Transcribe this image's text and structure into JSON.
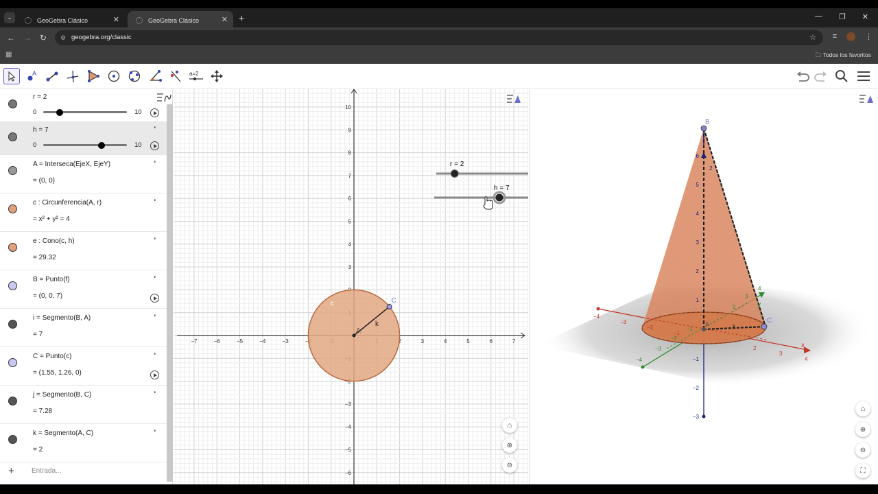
{
  "browser": {
    "tabs": [
      {
        "title": "GeoGebra Clásico",
        "active": false
      },
      {
        "title": "GeoGebra Clásico",
        "active": true
      }
    ],
    "url": "geogebra.org/classic",
    "bookmarks_label": "Todos los favoritos"
  },
  "colors": {
    "accent": "#6557d2",
    "cone_fill": "#d9835a",
    "circle_fill": "#e2a882",
    "point_blue": "#6666cc"
  },
  "toolbar": {
    "tools": [
      "move-tool",
      "point-tool",
      "line-tool",
      "perpendicular-tool",
      "polygon-tool",
      "circle-tool",
      "conic-tool",
      "angle-tool",
      "reflect-tool",
      "slider-tool",
      "move-view-tool"
    ],
    "slider_tool_label": "a=2",
    "right": [
      "undo-icon",
      "redo-icon",
      "search-icon",
      "menu-icon"
    ]
  },
  "algebra": {
    "input_placeholder": "Entrada...",
    "rows": [
      {
        "label": "r = 2",
        "min": "0",
        "max": "10",
        "value": 2,
        "marble": "#777777",
        "kind": "slider"
      },
      {
        "label": "h = 7",
        "min": "0",
        "max": "10",
        "value": 7,
        "marble": "#777777",
        "kind": "slider"
      },
      {
        "label": "A = Interseca(EjeX, EjeY)",
        "value": "= (0, 0)",
        "marble": "#999999"
      },
      {
        "label": "c : Circunferencia(A, r)",
        "value": "= x² + y² = 4",
        "marble": "#e0a07a"
      },
      {
        "label": "e : Cono(c, h)",
        "value": "= 29.32",
        "marble": "#e0a07a"
      },
      {
        "label": "B = Punto(f)",
        "value": "= (0, 0, 7)",
        "marble": "#c8c8f2",
        "play": true
      },
      {
        "label": "i = Segmento(B, A)",
        "value": "= 7",
        "marble": "#555555"
      },
      {
        "label": "C = Punto(c)",
        "value": "= (1.55, 1.26, 0)",
        "marble": "#c8c8f2",
        "play": true
      },
      {
        "label": "j = Segmento(B, C)",
        "value": "= 7.28",
        "marble": "#555555"
      },
      {
        "label": "k = Segmento(A, C)",
        "value": "= 2",
        "marble": "#555555"
      }
    ]
  },
  "graphics2d": {
    "x_ticks": [
      "−7",
      "−6",
      "−5",
      "−4",
      "−3",
      "−2",
      "−1",
      "1",
      "2",
      "3",
      "4",
      "5",
      "6",
      "7"
    ],
    "y_ticks": [
      "10",
      "9",
      "8",
      "7",
      "6",
      "5",
      "4",
      "3",
      "2",
      "1",
      "−1",
      "−2",
      "−3",
      "−4",
      "−5",
      "−6"
    ],
    "labels": {
      "A": "A",
      "C": "C",
      "c": "c",
      "k": "k"
    },
    "slider_r": {
      "label": "r = 2",
      "value": 2
    },
    "slider_h": {
      "label": "h = 7",
      "value": 7
    }
  },
  "graphics3d": {
    "labels": {
      "B": "B",
      "C": "C",
      "A": "A",
      "k": "k",
      "x": "x",
      "y": "y"
    },
    "z_ticks": [
      "6",
      "5",
      "4",
      "3",
      "2",
      "1",
      "−1",
      "−2",
      "−3"
    ],
    "x_ticks": [
      "−4",
      "−3",
      "−2",
      "−1",
      "1",
      "2",
      "3",
      "4"
    ],
    "y_ticks": [
      "−4",
      "−3",
      "−2",
      "−1",
      "1",
      "2",
      "3",
      "4"
    ],
    "z_top": "2"
  }
}
